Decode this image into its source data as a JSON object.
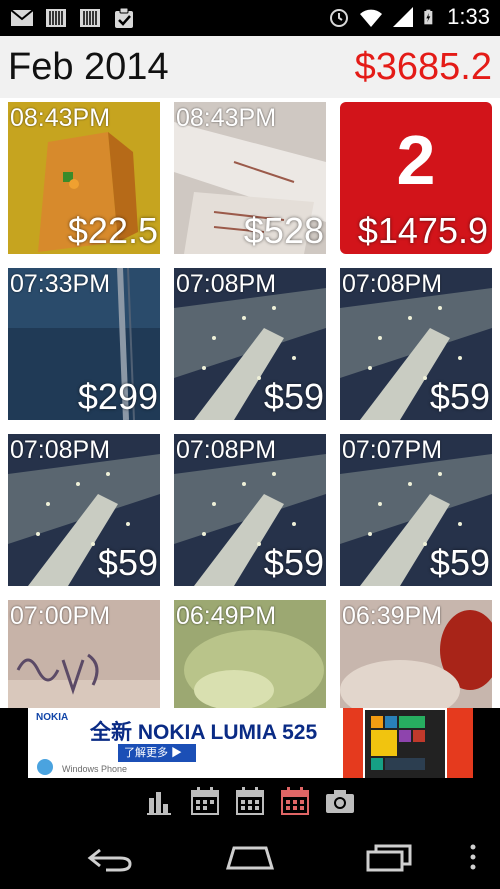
{
  "status_bar": {
    "clock": "1:33",
    "left_icons": [
      "gmail-icon",
      "barcode-icon",
      "barcode-icon",
      "clipboard-check-icon"
    ],
    "right_icons": [
      "alarm-icon",
      "wifi-icon",
      "signal-icon",
      "battery-charging-icon"
    ]
  },
  "header": {
    "month": "Feb 2014",
    "total": "$3685.2"
  },
  "summary_tile": {
    "count": "2",
    "amount": "$1475.9"
  },
  "tiles": [
    {
      "time": "08:43PM",
      "amount": "$22.5",
      "image": "orange-bag-photo"
    },
    {
      "time": "08:43PM",
      "amount": "$528",
      "image": "receipt-photo"
    },
    {
      "time": "07:33PM",
      "amount": "$299",
      "image": "denim-photo"
    },
    {
      "time": "07:08PM",
      "amount": "$59",
      "image": "sparkly-photo"
    },
    {
      "time": "07:08PM",
      "amount": "$59",
      "image": "sparkly-photo"
    },
    {
      "time": "07:08PM",
      "amount": "$59",
      "image": "sparkly-photo"
    },
    {
      "time": "07:08PM",
      "amount": "$59",
      "image": "sparkly-photo"
    },
    {
      "time": "07:07PM",
      "amount": "$59",
      "image": "sparkly-photo"
    },
    {
      "time": "07:00PM",
      "amount": "",
      "image": "handwriting-photo"
    },
    {
      "time": "06:49PM",
      "amount": "",
      "image": "green-food-photo"
    },
    {
      "time": "06:39PM",
      "amount": "",
      "image": "red-food-photo"
    }
  ],
  "ad": {
    "brand": "NOKIA",
    "headline": "全新 NOKIA LUMIA 525",
    "button": "了解更多 ▶",
    "footer": "Windows Phone"
  },
  "toolbar": {
    "icons": [
      "bar-chart-icon",
      "calendar-day-icon",
      "calendar-week-icon",
      "calendar-month-icon",
      "camera-icon"
    ],
    "active": "calendar-month-icon"
  },
  "colors": {
    "accent_red": "#e41b17",
    "summary_red": "#d2141a",
    "header_bg": "#f1f1f1"
  }
}
